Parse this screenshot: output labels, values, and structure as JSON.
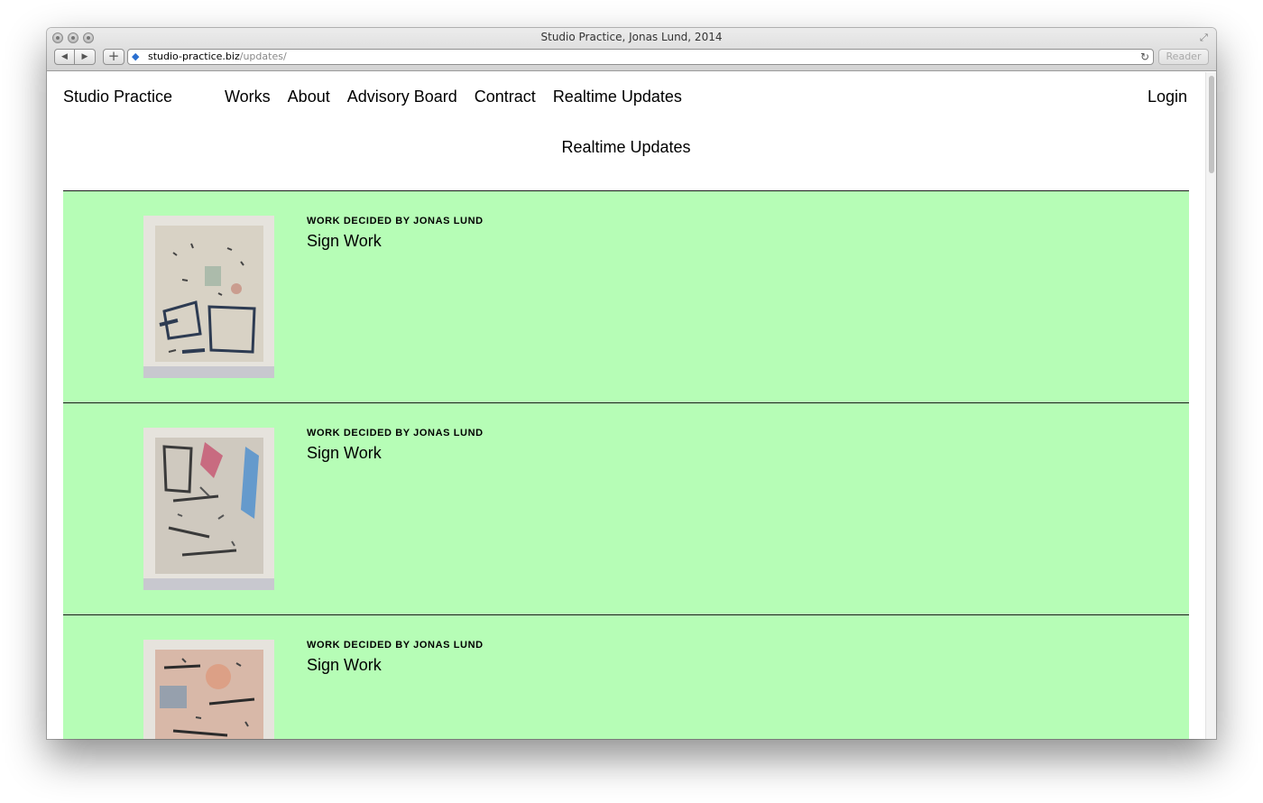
{
  "browser": {
    "window_title": "Studio Practice, Jonas Lund, 2014",
    "url_domain": "studio-practice.biz",
    "url_path": "/updates/",
    "reader_label": "Reader"
  },
  "nav": {
    "brand": "Studio Practice",
    "items": [
      "Works",
      "About",
      "Advisory Board",
      "Contract",
      "Realtime Updates"
    ],
    "login": "Login"
  },
  "page": {
    "heading": "Realtime Updates"
  },
  "updates": [
    {
      "kicker": "WORK DECIDED BY JONAS LUND",
      "title": "Sign Work",
      "palette": [
        "#d8d2c5",
        "#9ab0a0",
        "#2d3b52",
        "#c27a6a"
      ]
    },
    {
      "kicker": "WORK DECIDED BY JONAS LUND",
      "title": "Sign Work",
      "palette": [
        "#cfc9bf",
        "#4a8fd0",
        "#c55470",
        "#3a3a3a"
      ]
    },
    {
      "kicker": "WORK DECIDED BY JONAS LUND",
      "title": "Sign Work",
      "palette": [
        "#d8b8a8",
        "#6b8fb0",
        "#e09070",
        "#2b2b2b"
      ]
    }
  ]
}
